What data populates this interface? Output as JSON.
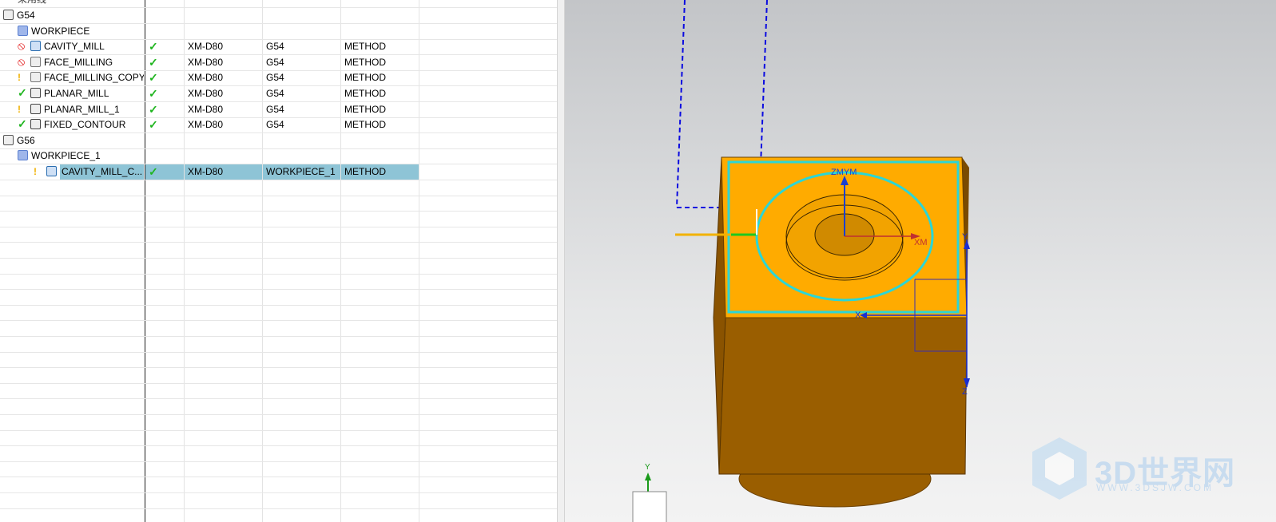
{
  "navigator": {
    "top_row_label": "采用线",
    "rows": [
      {
        "name": "G54",
        "indent": 0,
        "icon": "mcs-icon",
        "status": "",
        "check": "",
        "tool": "",
        "geometry": "",
        "method": ""
      },
      {
        "name": "WORKPIECE",
        "indent": 1,
        "icon": "workpiece-icon",
        "status": "",
        "check": "",
        "tool": "",
        "geometry": "",
        "method": ""
      },
      {
        "name": "CAVITY_MILL",
        "indent": 2,
        "icon": "cavity-mill-icon",
        "status": "prohibited",
        "check": "✓",
        "tool": "XM-D80",
        "geometry": "G54",
        "method": "METHOD"
      },
      {
        "name": "FACE_MILLING",
        "indent": 2,
        "icon": "face-milling-icon",
        "status": "prohibited",
        "check": "✓",
        "tool": "XM-D80",
        "geometry": "G54",
        "method": "METHOD"
      },
      {
        "name": "FACE_MILLING_COPY",
        "indent": 2,
        "icon": "face-milling-icon",
        "status": "warning",
        "check": "✓",
        "tool": "XM-D80",
        "geometry": "G54",
        "method": "METHOD"
      },
      {
        "name": "PLANAR_MILL",
        "indent": 2,
        "icon": "planar-mill-icon",
        "status": "complete",
        "check": "✓",
        "tool": "XM-D80",
        "geometry": "G54",
        "method": "METHOD"
      },
      {
        "name": "PLANAR_MILL_1",
        "indent": 2,
        "icon": "planar-mill-icon",
        "status": "warning",
        "check": "✓",
        "tool": "XM-D80",
        "geometry": "G54",
        "method": "METHOD"
      },
      {
        "name": "FIXED_CONTOUR",
        "indent": 2,
        "icon": "fixed-contour-icon",
        "status": "complete",
        "check": "✓",
        "tool": "XM-D80",
        "geometry": "G54",
        "method": "METHOD"
      },
      {
        "name": "G56",
        "indent": 0,
        "icon": "mcs-icon",
        "status": "",
        "check": "",
        "tool": "",
        "geometry": "",
        "method": ""
      },
      {
        "name": "WORKPIECE_1",
        "indent": 1,
        "icon": "workpiece-icon",
        "status": "",
        "check": "",
        "tool": "",
        "geometry": "",
        "method": ""
      },
      {
        "name": "CAVITY_MILL_C...",
        "indent": 3,
        "icon": "cavity-mill-icon",
        "status": "warning",
        "check": "✓",
        "tool": "XM-D80",
        "geometry": "WORKPIECE_1",
        "method": "METHOD",
        "selected": true
      }
    ]
  },
  "viewport": {
    "axis_labels": {
      "zm_ym": "ZMYM",
      "xm": "XM",
      "y": "Y",
      "x": "X",
      "z": "Z",
      "triad_y": "Y"
    },
    "colors": {
      "part_top": "#ffab00",
      "part_side": "#9a5e00",
      "toolpath": "#2bd6d6",
      "tool_line": "#0000e0"
    }
  },
  "watermark": {
    "main": "3D世界网",
    "sub": "WWW.3DSJW.COM"
  }
}
